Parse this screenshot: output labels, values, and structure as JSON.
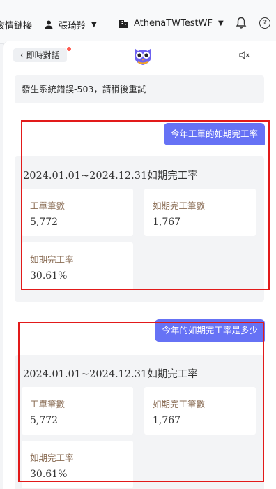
{
  "topbar": {
    "link_label": "夜情鏈接",
    "user_name": "張琦羚",
    "org_name": "AthenaTWTestWF",
    "caret": "▼",
    "help": "?"
  },
  "chat": {
    "back_label": "即時對話",
    "error_message": "發生系統錯誤-503，請稍後重試",
    "conversations": [
      {
        "question": "今年工單的如期完工率",
        "title": "2024.01.01~2024.12.31如期完工率",
        "stats": [
          {
            "label": "工單筆數",
            "value": "5,772"
          },
          {
            "label": "如期完工筆數",
            "value": "1,767"
          },
          {
            "label": "如期完工率",
            "value": "30.61%"
          }
        ]
      },
      {
        "question": "今年的如期完工率是多少",
        "title": "2024.01.01~2024.12.31如期完工率",
        "stats": [
          {
            "label": "工單筆數",
            "value": "5,772"
          },
          {
            "label": "如期完工筆數",
            "value": "1,767"
          },
          {
            "label": "如期完工率",
            "value": "30.61%"
          }
        ]
      }
    ]
  },
  "colors": {
    "accent": "#6672f5",
    "highlight": "#e21a1a",
    "card_bg": "#f3f4f6",
    "label": "#8a6d55"
  }
}
